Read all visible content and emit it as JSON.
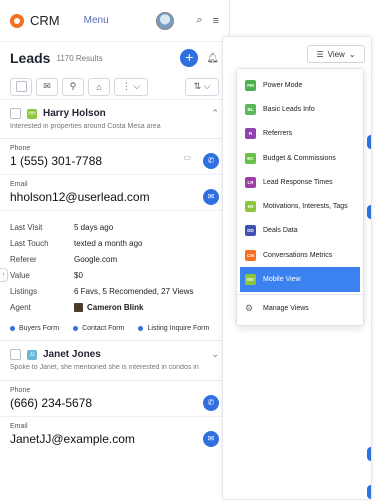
{
  "app": {
    "name": "CRM",
    "menu_label": "Menu"
  },
  "leads": {
    "title": "Leads",
    "count": "1170 Results"
  },
  "toolbar": {
    "more_label": "⋮ ⌵",
    "sort_label": "⇅ ⌵"
  },
  "lead1": {
    "tag": "HH",
    "name": "Harry Holson",
    "note": "Interested in properties around Costa Mesa area",
    "phone_label": "Phone",
    "phone": "1 (555) 301-7788",
    "email_label": "Email",
    "email": "hholson12@userlead.com",
    "details": [
      {
        "key": "Last Visit",
        "value": "5 days ago"
      },
      {
        "key": "Last Touch",
        "value": "texted a month ago"
      },
      {
        "key": "Referer",
        "value": "Google.com"
      },
      {
        "key": "Value",
        "value": "$0"
      },
      {
        "key": "Listings",
        "value": "6 Favs, 5 Recomended, 27 Views"
      }
    ],
    "agent_label": "Agent",
    "agent": "Cameron Blink",
    "forms": [
      "Buyers Form",
      "Contact Form",
      "Listing Inquire Form"
    ]
  },
  "lead2": {
    "tag": "JJ",
    "name": "Janet Jones",
    "note": "Spoke to Janet, she mentioned she is interested in condos in",
    "phone_label": "Phone",
    "phone": "(666) 234-5678",
    "email_label": "Email",
    "email": "JanetJJ@example.com"
  },
  "view": {
    "label": "View"
  },
  "dropdown": {
    "items": [
      {
        "abbr": "PM",
        "label": "Power Mode",
        "color": "#4caf50"
      },
      {
        "abbr": "BL",
        "label": "Basic Leads Info",
        "color": "#5cb85c"
      },
      {
        "abbr": "R",
        "label": "Referrers",
        "color": "#8e44ad"
      },
      {
        "abbr": "BC",
        "label": "Budget & Commissions",
        "color": "#6abf4b"
      },
      {
        "abbr": "LR",
        "label": "Lead Response Times",
        "color": "#9b3fa6"
      },
      {
        "abbr": "MI",
        "label": "Motivations, Interests, Tags",
        "color": "#8cc63f"
      },
      {
        "abbr": "DD",
        "label": "Deals Data",
        "color": "#3f51b5"
      },
      {
        "abbr": "CM",
        "label": "Conversations Metrics",
        "color": "#f37021"
      },
      {
        "abbr": "MV",
        "label": "Mobile View",
        "color": "#8cc63f"
      }
    ],
    "manage_label": "Manage Views"
  }
}
